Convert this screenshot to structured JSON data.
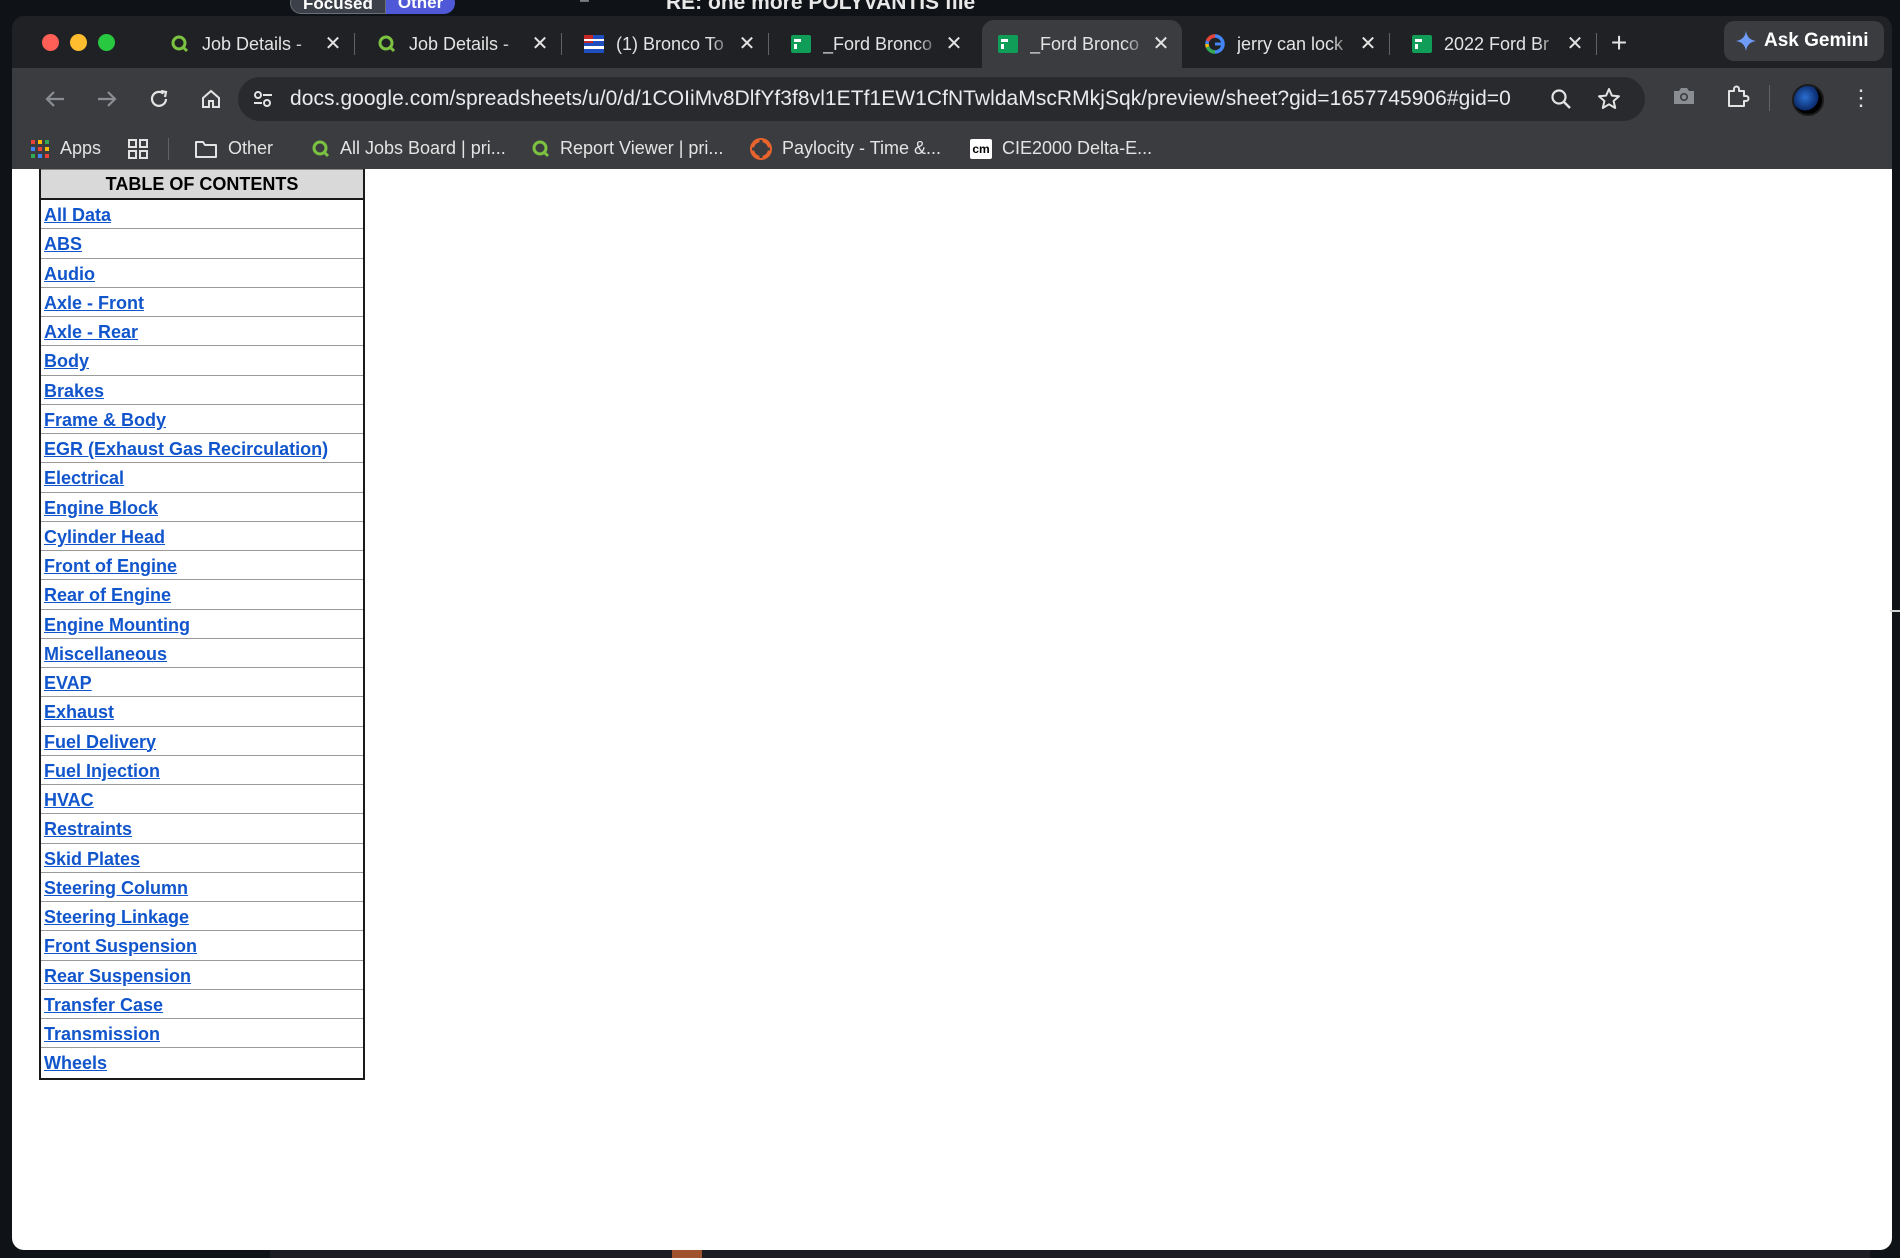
{
  "background_app": {
    "pill_focused": "Focused",
    "pill_other": "Other",
    "email_subject": "RE: one more POLYVANTIS file"
  },
  "browser": {
    "tabs": [
      {
        "title": "Job Details -",
        "icon": "green-search-icon",
        "active": false
      },
      {
        "title": "Job Details -",
        "icon": "green-search-icon",
        "active": false
      },
      {
        "title": "(1) Bronco To",
        "icon": "flag-icon",
        "active": false
      },
      {
        "title": "_Ford Bronco",
        "icon": "sheets-icon",
        "active": false
      },
      {
        "title": "_Ford Bronco",
        "icon": "sheets-icon",
        "active": true
      },
      {
        "title": "jerry can lock",
        "icon": "google-icon",
        "active": false
      },
      {
        "title": "2022 Ford Br",
        "icon": "sheets-icon",
        "active": false
      }
    ],
    "new_tab_label": "+",
    "ask_gemini_label": "Ask Gemini",
    "url": "docs.google.com/spreadsheets/u/0/d/1COIiMv8DlfYf3f8vl1ETf1EW1CfNTwldaMscRMkjSqk/preview/sheet?gid=1657745906#gid=0",
    "bookmarks": [
      {
        "label": "Apps",
        "icon": "apps-grid-icon"
      },
      {
        "label": "",
        "icon": "tab-groups-icon"
      },
      {
        "label": "Other",
        "icon": "folder-icon"
      },
      {
        "label": "All Jobs Board | pri...",
        "icon": "green-search-icon"
      },
      {
        "label": "Report Viewer | pri...",
        "icon": "green-search-icon"
      },
      {
        "label": "Paylocity - Time &...",
        "icon": "paylocity-icon"
      },
      {
        "label": "CIE2000 Delta-E...",
        "icon": "cm-icon",
        "icon_text": "cm"
      }
    ],
    "colors": {
      "frame": "#202124",
      "toolbar": "#3b3c3f",
      "link": "#1155cc",
      "sheets_green": "#0f9d58"
    }
  },
  "sheet": {
    "toc_header": "TABLE OF CONTENTS",
    "toc_items": [
      "All Data",
      "ABS",
      "Audio",
      "Axle - Front",
      "Axle - Rear",
      "Body",
      "Brakes",
      "Frame & Body",
      "EGR (Exhaust Gas Recirculation)",
      "Electrical",
      "Engine Block",
      "Cylinder Head",
      "Front of Engine",
      "Rear of Engine",
      "Engine Mounting",
      "Miscellaneous",
      "EVAP",
      "Exhaust",
      "Fuel Delivery",
      "Fuel Injection",
      "HVAC",
      "Restraints",
      "Skid Plates",
      "Steering Column",
      "Steering Linkage",
      "Front Suspension",
      "Rear Suspension",
      "Transfer Case",
      "Transmission",
      "Wheels"
    ]
  }
}
